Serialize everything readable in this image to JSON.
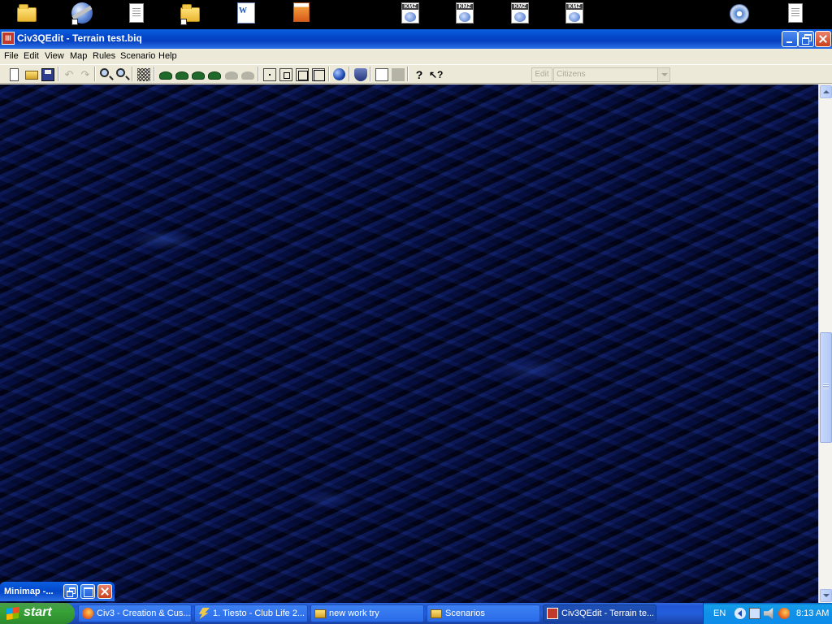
{
  "window": {
    "title": "Civ3QEdit - Terrain test.biq",
    "app_icon_glyph": "III"
  },
  "menu": [
    "File",
    "Edit",
    "View",
    "Map",
    "Rules",
    "Scenario",
    "Help"
  ],
  "toolbar": {
    "edit_button_label": "Edit",
    "combo_value": "Citizens"
  },
  "desktop_icons": [
    {
      "icon": "folder-icon"
    },
    {
      "icon": "google-earth-icon"
    },
    {
      "icon": "document-icon"
    },
    {
      "icon": "folder-shortcut-icon"
    },
    {
      "icon": "word-document-icon",
      "glyph": "W"
    },
    {
      "icon": "archive-icon"
    },
    {
      "icon": "kmz-file-icon",
      "badge": "KMZ"
    },
    {
      "icon": "kmz-file-icon",
      "badge": "KMZ"
    },
    {
      "icon": "kmz-file-icon",
      "badge": "KMZ"
    },
    {
      "icon": "kmz-file-icon",
      "badge": "KMZ"
    },
    {
      "icon": "media-player-icon"
    },
    {
      "icon": "document-icon"
    }
  ],
  "minimap": {
    "title": "Minimap -..."
  },
  "taskbar": {
    "start_label": "start",
    "tasks": [
      {
        "label": "Civ3 - Creation & Cus...",
        "icon": "firefox-icon"
      },
      {
        "label": "1. Tiesto - Club Life 2...",
        "icon": "winamp-icon"
      },
      {
        "label": "new work try",
        "icon": "folder-icon"
      },
      {
        "label": "Scenarios",
        "icon": "folder-icon"
      },
      {
        "label": "Civ3QEdit - Terrain te...",
        "icon": "civ3qedit-icon"
      }
    ],
    "tray": {
      "language": "EN",
      "time": "8:13 AM"
    }
  }
}
